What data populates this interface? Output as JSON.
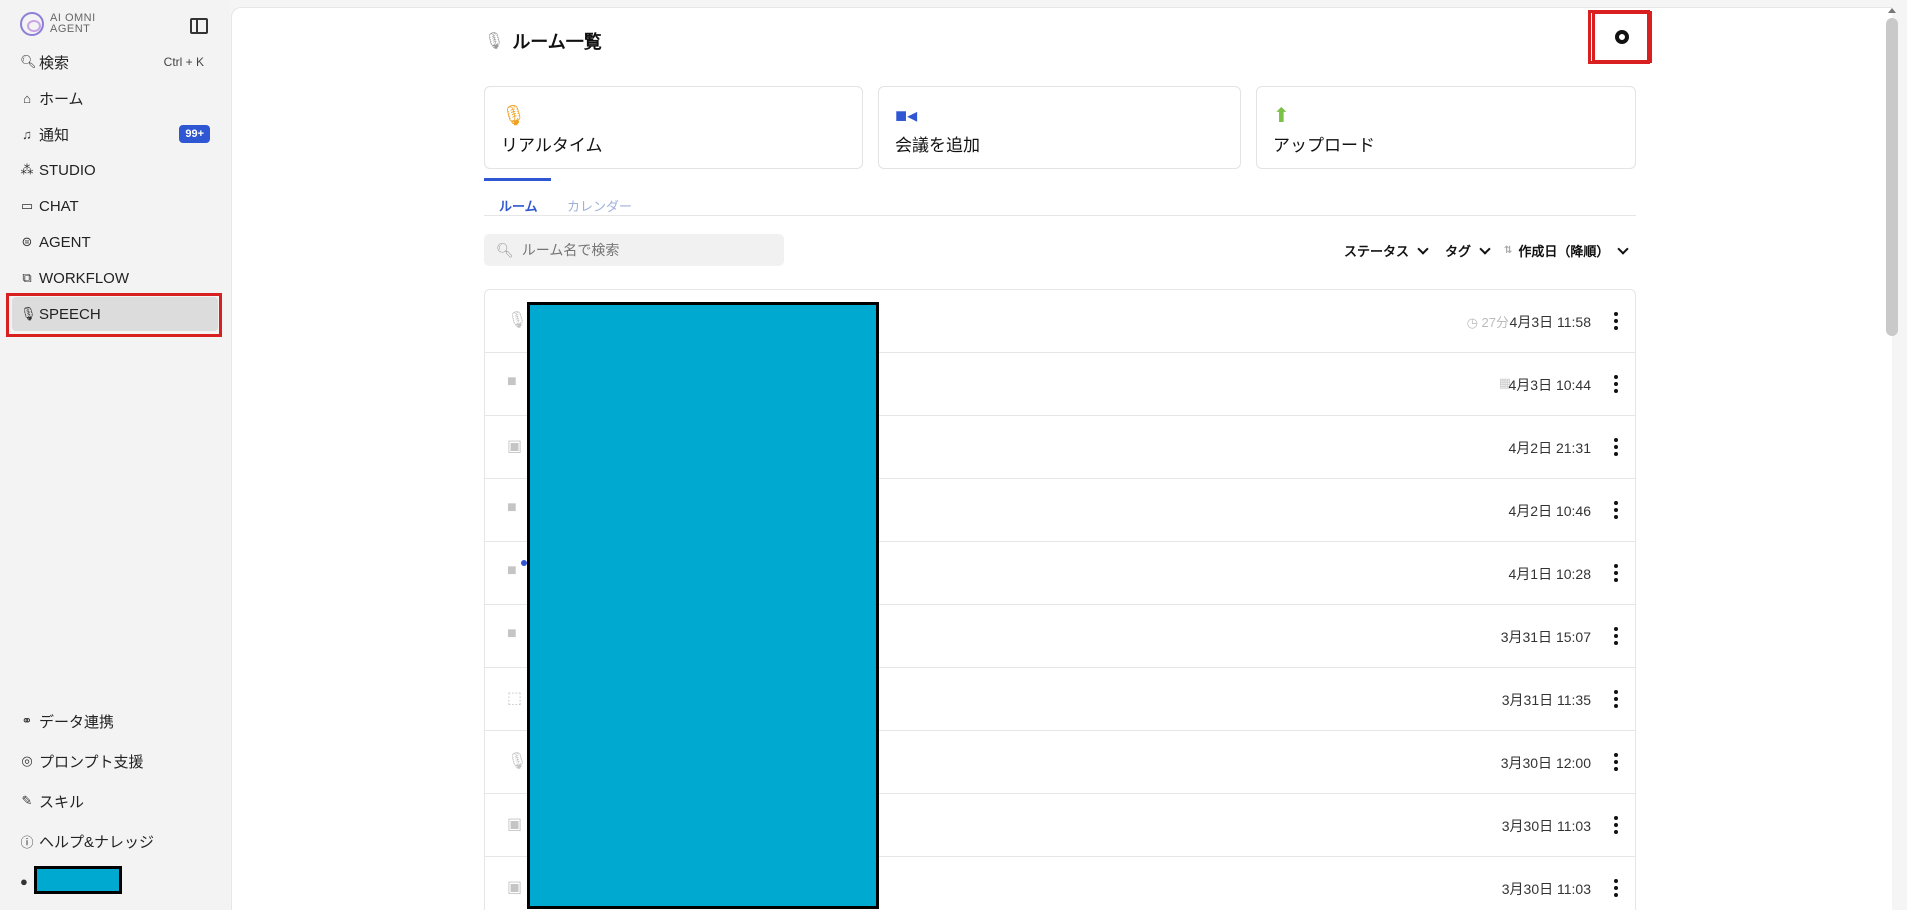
{
  "sidebar": {
    "logo_text": "AI OMNI AGENT",
    "search": {
      "label": "検索",
      "shortcut": "Ctrl + K"
    },
    "items": [
      {
        "label": "ホーム"
      },
      {
        "label": "通知",
        "badge": "99+"
      },
      {
        "label": "STUDIO"
      },
      {
        "label": "CHAT"
      },
      {
        "label": "AGENT"
      },
      {
        "label": "WORKFLOW"
      },
      {
        "label": "SPEECH"
      }
    ],
    "bottom_items": [
      {
        "label": "データ連携"
      },
      {
        "label": "プロンプト支援"
      },
      {
        "label": "スキル"
      },
      {
        "label": "ヘルプ&ナレッジ"
      }
    ]
  },
  "header": {
    "title": "ルーム一覧"
  },
  "cards": [
    {
      "label": "リアルタイム",
      "icon": "mic-icon",
      "color": "#f0a020"
    },
    {
      "label": "会議を追加",
      "icon": "video-icon",
      "color": "#2f57d3"
    },
    {
      "label": "アップロード",
      "icon": "upload-icon",
      "color": "#7cc24a"
    }
  ],
  "tabs": [
    {
      "label": "ルーム",
      "active": true
    },
    {
      "label": "カレンダー",
      "active": false
    }
  ],
  "search": {
    "placeholder": "ルーム名で検索"
  },
  "filters": {
    "status": "ステータス",
    "tag": "タグ",
    "sort": "作成日（降順）"
  },
  "rooms": [
    {
      "icon": "mic-icon",
      "duration": "27分",
      "date": "4月3日 11:58"
    },
    {
      "icon": "video-icon",
      "date": "4月3日 10:44"
    },
    {
      "icon": "media-file-icon",
      "date": "4月2日 21:31"
    },
    {
      "icon": "video-icon",
      "date": "4月2日 10:46"
    },
    {
      "icon": "video-icon",
      "date": "4月1日 10:28"
    },
    {
      "icon": "video-icon",
      "date": "3月31日 15:07"
    },
    {
      "icon": "draft-icon",
      "date": "3月31日 11:35"
    },
    {
      "icon": "mic-icon",
      "date": "3月30日 12:00"
    },
    {
      "icon": "media-file-icon",
      "date": "3月30日 11:03"
    },
    {
      "icon": "media-file-icon",
      "date": "3月30日 11:03"
    }
  ]
}
